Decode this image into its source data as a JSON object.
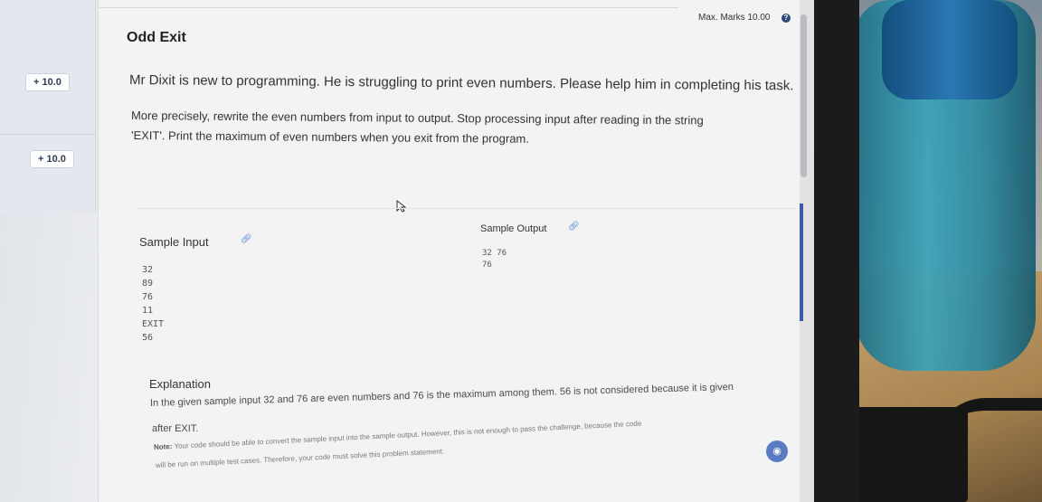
{
  "header": {
    "max_marks": "Max. Marks 10.00"
  },
  "question": {
    "title": "Odd Exit",
    "description": "Mr Dixit is new to programming. He is struggling to print even numbers. Please help him in completing his task.",
    "detail_line1": "More precisely, rewrite the even numbers from input to output. Stop processing input after reading in the string",
    "detail_line2": "'EXIT'. Print the maximum of even numbers when you exit from the program."
  },
  "left_panel": {
    "marks_1": "+ 10.0",
    "marks_2": "+ 10.0"
  },
  "sample_input": {
    "label": "Sample Input",
    "lines": [
      "32",
      "89",
      "76",
      "11",
      "EXIT",
      "56"
    ]
  },
  "sample_output": {
    "label": "Sample Output",
    "lines": [
      "32 76",
      "76"
    ]
  },
  "explanation": {
    "label": "Explanation",
    "line1": "In the given sample input 32 and 76 are even numbers and 76 is the maximum among them. 56 is not considered because it is given",
    "line2": "after EXIT."
  },
  "note": {
    "label": "Note:",
    "line1": "Your code should be able to convert the sample input into the sample output. However, this is not enough to pass the challenge, because the code",
    "line2": "will be run on multiple test cases. Therefore, your code must solve this problem statement."
  },
  "icons": {
    "help": "question-circle-icon",
    "link": "link-icon",
    "cursor": "mouse-pointer-icon",
    "chat": "chat-icon"
  },
  "colors": {
    "accent": "#3b5ca8",
    "link": "#4a7fd0",
    "help_icon": "#2d4a78"
  }
}
